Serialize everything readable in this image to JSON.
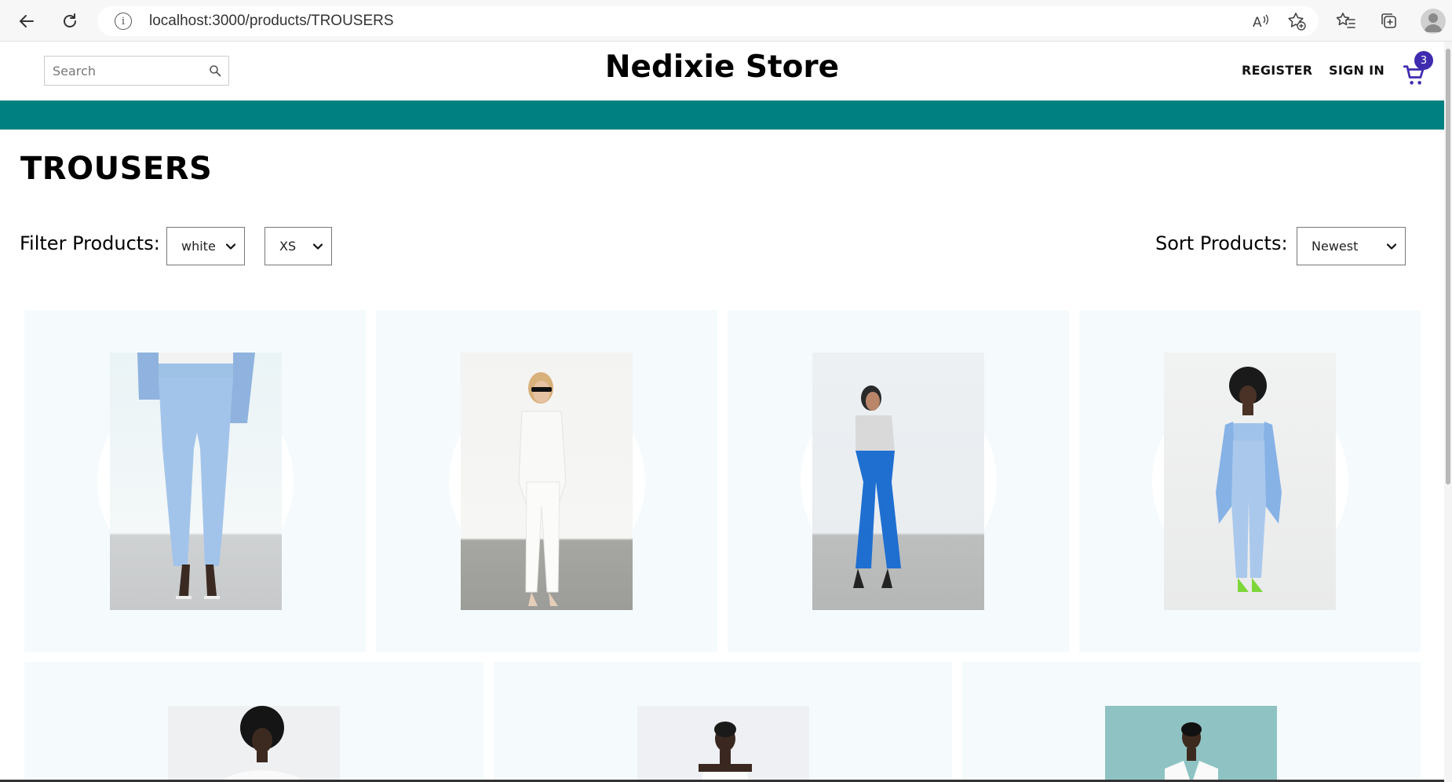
{
  "browser": {
    "url": "localhost:3000/products/TROUSERS",
    "icons": [
      "back-arrow-icon",
      "reload-icon",
      "site-info-icon",
      "read-aloud-icon",
      "add-favorite-icon",
      "favorites-icon",
      "collections-icon",
      "profile-icon"
    ]
  },
  "header": {
    "search_placeholder": "Search",
    "store_name": "Nedixie Store",
    "register_label": "REGISTER",
    "signin_label": "SIGN IN",
    "cart_count": "3"
  },
  "page": {
    "title": "TROUSERS",
    "filter_label": "Filter Products:",
    "color_filter": "white",
    "size_filter": "XS",
    "sort_label": "Sort Products:",
    "sort_value": "Newest"
  },
  "colors": {
    "accent_band": "#008080",
    "cart_badge": "#3f2bb0",
    "card_background": "#f5fbfd"
  },
  "products": [
    {
      "image": "light blue tailored trousers with belt and blazer"
    },
    {
      "image": "white shirt and white trousers"
    },
    {
      "image": "grey top and bright blue flared trousers"
    },
    {
      "image": "light blue strapless top, blazer and trousers"
    },
    {
      "image": "white off-shoulder top"
    },
    {
      "image": "white strapless top"
    },
    {
      "image": "white blazer on teal background"
    }
  ]
}
